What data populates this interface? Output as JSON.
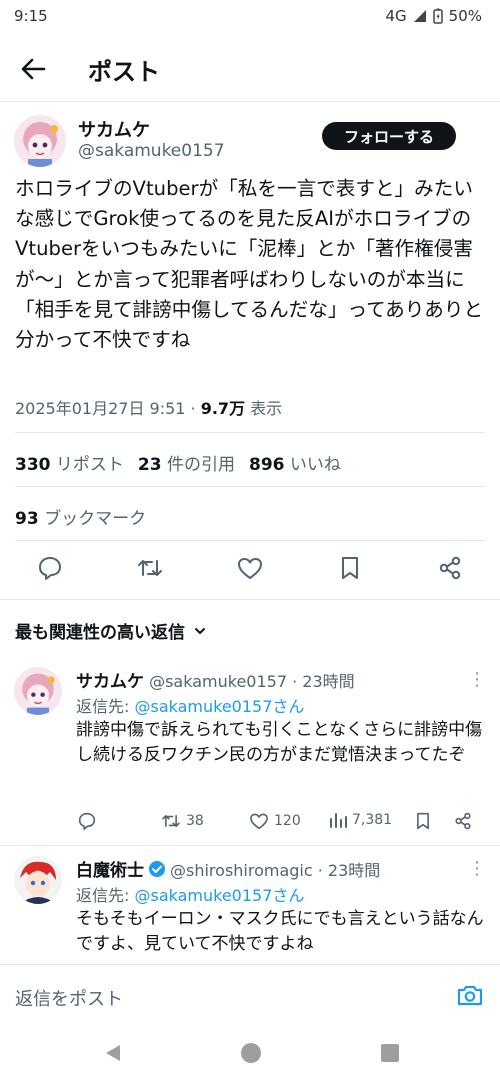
{
  "status": {
    "time": "9:15",
    "network": "4G",
    "battery": "50%"
  },
  "header": {
    "title": "ポスト"
  },
  "post": {
    "name": "サカムケ",
    "handle": "@sakamuke0157",
    "follow_label": "フォローする",
    "text": "ホロライブのVtuberが「私を一言で表すと」みたいな感じでGrok使ってるのを見た反AIがホロライブのVtuberをいつもみたいに「泥棒」とか「著作権侵害が〜」とか言って犯罪者呼ばわりしないのが本当に「相手を見て誹謗中傷してるんだな」ってありありと分かって不快ですね",
    "timestamp": "2025年01月27日 9:51 · ",
    "views_value": "9.7万",
    "views_label": " 表示",
    "reposts": "330",
    "reposts_label": "リポスト",
    "quotes": "23",
    "quotes_label": "件の引用",
    "likes": "896",
    "likes_label": "いいね",
    "bookmarks": "93",
    "bookmarks_label": "ブックマーク"
  },
  "sort_label": "最も関連性の高い返信",
  "replies": [
    {
      "name": "サカムケ",
      "meta": "@sakamuke0157 · 23時間",
      "reply_prefix": "返信先: ",
      "reply_to": "@sakamuke0157さん",
      "text": "誹謗中傷で訴えられても引くことなくさらに誹謗中傷し続ける反ワクチン民の方がまだ覚悟決まってたぞ",
      "reposts": "38",
      "likes": "120",
      "views": "7,381"
    },
    {
      "name": "白魔術士",
      "meta": "@shiroshiromagic · 23時間",
      "reply_prefix": "返信先: ",
      "reply_to": "@sakamuke0157さん",
      "text": "そもそもイーロン・マスク氏にでも言えという話なんですよ、見ていて不快ですよね"
    }
  ],
  "compose": {
    "placeholder": "返信をポスト"
  }
}
